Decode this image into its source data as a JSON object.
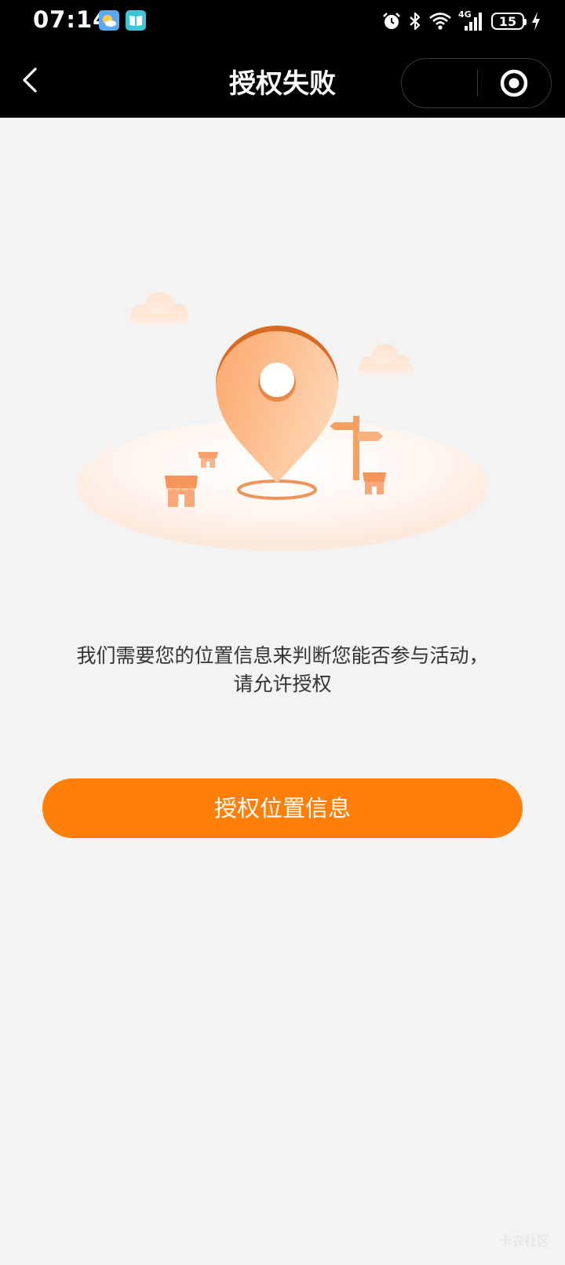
{
  "status_bar": {
    "time": "07:14",
    "network": "4G",
    "battery": "15"
  },
  "nav": {
    "title": "授权失败"
  },
  "content": {
    "message": "我们需要您的位置信息来判断您能否参与活动， 请允许授权",
    "button_label": "授权位置信息"
  },
  "watermark": "卡农社区",
  "colors": {
    "accent": "#ff7f09",
    "background": "#f3f3f3",
    "bar": "#000000"
  },
  "icons": [
    "weather-icon",
    "reader-icon",
    "alarm-icon",
    "bluetooth-icon",
    "wifi-icon",
    "signal-icon",
    "battery-icon",
    "charging-icon",
    "back-icon",
    "more-icon",
    "close-target-icon",
    "location-pin-icon"
  ]
}
